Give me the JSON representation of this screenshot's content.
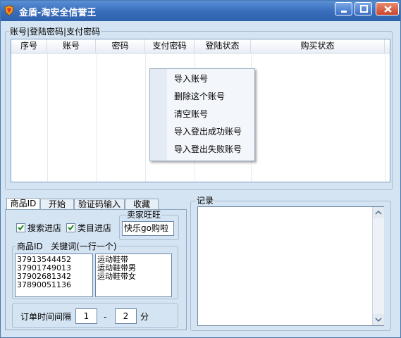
{
  "window": {
    "title": "金盾-淘安全信誉王"
  },
  "accounts_group": {
    "label": "账号|登陆密码|支付密码",
    "columns": [
      "序号",
      "账号",
      "密码",
      "支付密码",
      "登陆状态",
      "购买状态"
    ]
  },
  "context_menu": {
    "items": [
      "导入账号",
      "删除这个账号",
      "清空账号",
      "导入登出成功账号",
      "导入登出失败账号"
    ]
  },
  "tabs": [
    "商品ID",
    "开始",
    "验证码输入",
    "收藏"
  ],
  "product_tab": {
    "search_shop_label": "搜索进店",
    "category_shop_label": "类目进店",
    "seller_label": "卖家旺旺",
    "seller_value": "快乐go购啦",
    "ids_label": "商品ID   关键词(一行一个)",
    "product_ids": [
      "37913544452",
      "37901749013",
      "37902681342",
      "37890051136"
    ],
    "keywords": [
      "运动鞋带",
      "运动鞋带男",
      "运动鞋带女"
    ],
    "interval_label": "订单时间间隔",
    "interval_from": "1",
    "interval_dash": "-",
    "interval_to": "2",
    "interval_unit": "分"
  },
  "log_group": {
    "label": "记录"
  },
  "colors": {
    "background": "#d5e4f2",
    "titlebar": "#3a6fbd"
  },
  "icons": [
    "shield-icon",
    "minimize-icon",
    "maximize-icon",
    "close-icon",
    "checkbox-checked-icon",
    "scroll-up-icon",
    "scroll-down-icon"
  ]
}
